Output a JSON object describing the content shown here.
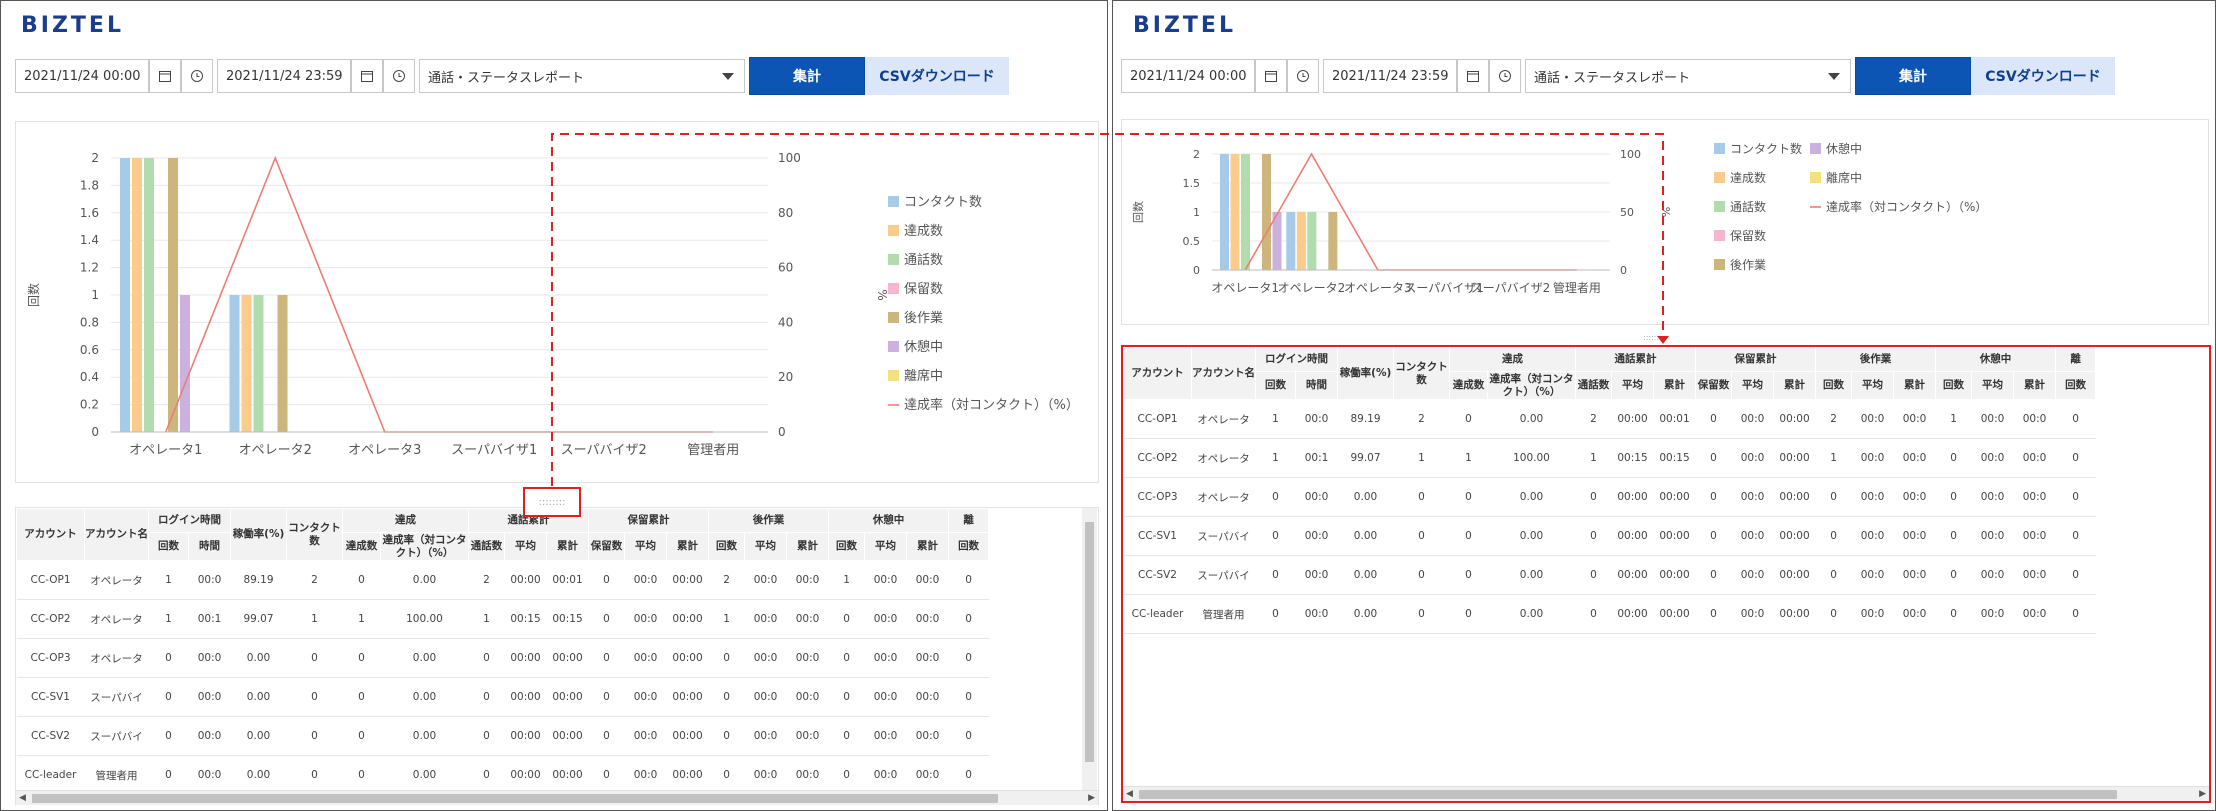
{
  "logo": "BIZTEL",
  "filters": {
    "start": "2021/11/24 00:00",
    "end": "2021/11/24 23:59",
    "report_type": "通話・ステータスレポート",
    "aggregate_label": "集計",
    "csv_label": "CSVダウンロード"
  },
  "chart_data": {
    "type": "bar",
    "categories": [
      "オペレータ1",
      "オペレータ2",
      "オペレータ3",
      "スーパバイザ1",
      "スーパバイザ2",
      "管理者用"
    ],
    "ylabel": "回数",
    "y2label": "%",
    "ylim": [
      0,
      2
    ],
    "y2lim": [
      0,
      100
    ],
    "series": [
      {
        "name": "コンタクト数",
        "color": "#a5cbe8",
        "values": [
          2,
          1,
          0,
          0,
          0,
          0
        ]
      },
      {
        "name": "達成数",
        "color": "#fbcb8c",
        "values": [
          2,
          1,
          0,
          0,
          0,
          0
        ]
      },
      {
        "name": "通話数",
        "color": "#b1dcae",
        "values": [
          2,
          1,
          0,
          0,
          0,
          0
        ]
      },
      {
        "name": "保留数",
        "color": "#f7b5cf",
        "values": [
          0,
          0,
          0,
          0,
          0,
          0
        ]
      },
      {
        "name": "後作業",
        "color": "#ccb67e",
        "values": [
          2,
          1,
          0,
          0,
          0,
          0
        ]
      },
      {
        "name": "休憩中",
        "color": "#cbb1de",
        "values": [
          1,
          0,
          0,
          0,
          0,
          0
        ]
      },
      {
        "name": "離席中",
        "color": "#f3e07e",
        "values": [
          0,
          0,
          0,
          0,
          0,
          0
        ]
      }
    ],
    "line": {
      "name": "達成率（対コンタクト）（%）",
      "color": "#f07c74",
      "values": [
        0,
        100,
        0,
        0,
        0,
        0
      ]
    },
    "legend_left": [
      "コンタクト数",
      "達成数",
      "通話数",
      "保留数",
      "後作業",
      "休憩中",
      "離席中",
      "達成率（対コンタクト）（%）"
    ],
    "legend_right": [
      [
        "コンタクト数",
        "休憩中"
      ],
      [
        "達成数",
        "離席中"
      ],
      [
        "通話数",
        "達成率（対コンタクト）（%）"
      ],
      [
        "保留数",
        ""
      ],
      [
        "後作業",
        ""
      ]
    ],
    "yticks_left": [
      "0",
      "0.2",
      "0.4",
      "0.6",
      "0.8",
      "1",
      "1.2",
      "1.4",
      "1.6",
      "1.8",
      "2"
    ],
    "y2ticks_left": [
      "0",
      "20",
      "40",
      "60",
      "80",
      "100"
    ],
    "yticks_right": [
      "0",
      "0.5",
      "1",
      "1.5",
      "2"
    ],
    "y2ticks_right": [
      "0",
      "50",
      "100"
    ]
  },
  "table": {
    "header_top": [
      {
        "label": "アカウント",
        "colspan": 1,
        "rowspan": 2
      },
      {
        "label": "アカウント名",
        "colspan": 1,
        "rowspan": 2
      },
      {
        "label": "ログイン時間",
        "colspan": 2,
        "rowspan": 1
      },
      {
        "label": "稼働率(%)",
        "colspan": 1,
        "rowspan": 2
      },
      {
        "label": "コンタクト数",
        "colspan": 1,
        "rowspan": 2
      },
      {
        "label": "達成",
        "colspan": 2,
        "rowspan": 1
      },
      {
        "label": "通話累計",
        "colspan": 3,
        "rowspan": 1
      },
      {
        "label": "保留累計",
        "colspan": 3,
        "rowspan": 1
      },
      {
        "label": "後作業",
        "colspan": 3,
        "rowspan": 1
      },
      {
        "label": "休憩中",
        "colspan": 3,
        "rowspan": 1
      },
      {
        "label": "離",
        "colspan": 1,
        "rowspan": 1
      }
    ],
    "header_sub": [
      "回数",
      "時間",
      "達成数",
      "達成率（対コンタクト）（%）",
      "通話数",
      "平均",
      "累計",
      "保留数",
      "平均",
      "累計",
      "回数",
      "平均",
      "累計",
      "回数",
      "平均",
      "累計",
      "回数"
    ],
    "rows": [
      [
        "CC-OP1",
        "オペレータ",
        "1",
        "00:0",
        "89.19",
        "2",
        "0",
        "0.00",
        "2",
        "00:00",
        "00:01",
        "0",
        "00:0",
        "00:00",
        "2",
        "00:0",
        "00:0",
        "1",
        "00:0",
        "00:0",
        "0"
      ],
      [
        "CC-OP2",
        "オペレータ",
        "1",
        "00:1",
        "99.07",
        "1",
        "1",
        "100.00",
        "1",
        "00:15",
        "00:15",
        "0",
        "00:0",
        "00:00",
        "1",
        "00:0",
        "00:0",
        "0",
        "00:0",
        "00:0",
        "0"
      ],
      [
        "CC-OP3",
        "オペレータ",
        "0",
        "00:0",
        "0.00",
        "0",
        "0",
        "0.00",
        "0",
        "00:00",
        "00:00",
        "0",
        "00:0",
        "00:00",
        "0",
        "00:0",
        "00:0",
        "0",
        "00:0",
        "00:0",
        "0"
      ],
      [
        "CC-SV1",
        "スーパバイ",
        "0",
        "00:0",
        "0.00",
        "0",
        "0",
        "0.00",
        "0",
        "00:00",
        "00:00",
        "0",
        "00:0",
        "00:00",
        "0",
        "00:0",
        "00:0",
        "0",
        "00:0",
        "00:0",
        "0"
      ],
      [
        "CC-SV2",
        "スーパバイ",
        "0",
        "00:0",
        "0.00",
        "0",
        "0",
        "0.00",
        "0",
        "00:00",
        "00:00",
        "0",
        "00:0",
        "00:00",
        "0",
        "00:0",
        "00:0",
        "0",
        "00:0",
        "00:0",
        "0"
      ],
      [
        "CC-leader",
        "管理者用",
        "0",
        "00:0",
        "0.00",
        "0",
        "0",
        "0.00",
        "0",
        "00:00",
        "00:00",
        "0",
        "00:0",
        "00:00",
        "0",
        "00:0",
        "00:0",
        "0",
        "00:0",
        "00:0",
        "0"
      ]
    ]
  },
  "splitter_handle": "::::::::",
  "colors": {
    "brand": "#1a3e8c",
    "primary": "#0d55b5",
    "secondary": "#dbe6f8",
    "highlight": "#e02020",
    "line": "#f07c74"
  }
}
